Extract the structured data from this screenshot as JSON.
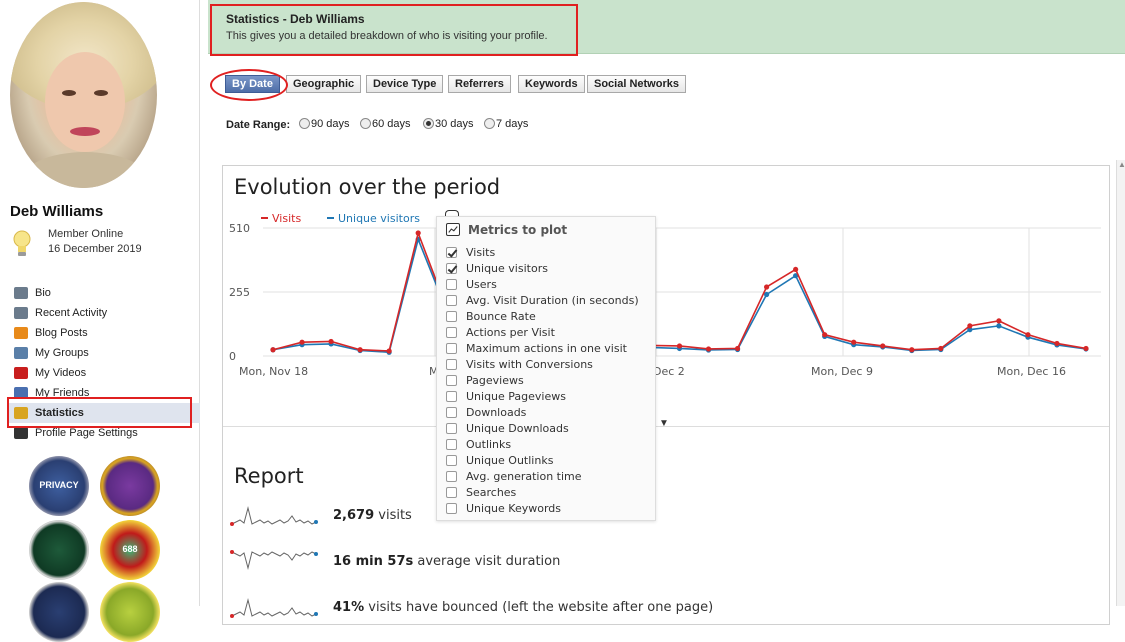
{
  "profile": {
    "name": "Deb Williams",
    "status": "Member Online",
    "date": "16 December 2019"
  },
  "sidebar": {
    "items": [
      {
        "label": "Bio",
        "icon": "document-icon",
        "color": "#6b7b8c"
      },
      {
        "label": "Recent Activity",
        "icon": "activity-icon",
        "color": "#6b7b8c"
      },
      {
        "label": "Blog Posts",
        "icon": "rss-icon",
        "color": "#e88a1a"
      },
      {
        "label": "My Groups",
        "icon": "groups-icon",
        "color": "#5a7fa8"
      },
      {
        "label": "My Videos",
        "icon": "video-icon",
        "color": "#c81e1e"
      },
      {
        "label": "My Friends",
        "icon": "friends-icon",
        "color": "#4a6fb0"
      },
      {
        "label": "Statistics",
        "icon": "bar-chart-icon",
        "color": "#d8a420"
      },
      {
        "label": "Profile Page Settings",
        "icon": "gear-icon",
        "color": "#333333"
      }
    ],
    "active_index": 6,
    "badges": [
      {
        "name": "privacy-badge",
        "label": "PRIVACY"
      },
      {
        "name": "royal-badge",
        "label": ""
      },
      {
        "name": "shield-badge",
        "label": ""
      },
      {
        "name": "mvp-rank-badge",
        "label": "688"
      },
      {
        "name": "anchor-badge",
        "label": ""
      },
      {
        "name": "member-badge",
        "label": ""
      }
    ]
  },
  "banner": {
    "title": "Statistics - Deb Williams",
    "subtitle": "This gives you a detailed breakdown of who is visiting your profile."
  },
  "tabs": [
    {
      "label": "By Date",
      "active": true
    },
    {
      "label": "Geographic"
    },
    {
      "label": "Device Type"
    },
    {
      "label": "Referrers"
    },
    {
      "label": "Keywords"
    },
    {
      "label": "Social Networks"
    }
  ],
  "date_range": {
    "label": "Date Range:",
    "options": [
      "90 days",
      "60 days",
      "30 days",
      "7 days"
    ],
    "selected": "30 days"
  },
  "evolution": {
    "title": "Evolution over the period"
  },
  "chart_data": {
    "type": "line",
    "ylim": [
      0,
      510
    ],
    "yticks": [
      0,
      255,
      510
    ],
    "xtick_labels": [
      "Mon, Nov 18",
      "M",
      "Dec 2",
      "Mon, Dec 9",
      "Mon, Dec 16"
    ],
    "legend": "top-left",
    "grid": true,
    "series": [
      {
        "name": "Visits",
        "color": "#d62728",
        "values": [
          25,
          55,
          58,
          25,
          20,
          490,
          185,
          0,
          0,
          0,
          0,
          0,
          0,
          42,
          40,
          28,
          30,
          275,
          345,
          85,
          55,
          40,
          25,
          30,
          120,
          140,
          85,
          50,
          30
        ]
      },
      {
        "name": "Unique visitors",
        "color": "#1f77b4",
        "values": [
          25,
          45,
          48,
          22,
          15,
          465,
          175,
          0,
          0,
          0,
          0,
          0,
          0,
          34,
          30,
          24,
          26,
          245,
          320,
          78,
          45,
          36,
          22,
          26,
          105,
          120,
          75,
          44,
          28
        ]
      }
    ]
  },
  "metrics": {
    "title": "Metrics to plot",
    "items": [
      {
        "label": "Visits",
        "checked": true
      },
      {
        "label": "Unique visitors",
        "checked": true
      },
      {
        "label": "Users",
        "checked": false
      },
      {
        "label": "Avg. Visit Duration (in seconds)",
        "checked": false
      },
      {
        "label": "Bounce Rate",
        "checked": false
      },
      {
        "label": "Actions per Visit",
        "checked": false
      },
      {
        "label": "Maximum actions in one visit",
        "checked": false
      },
      {
        "label": "Visits with Conversions",
        "checked": false
      },
      {
        "label": "Pageviews",
        "checked": false
      },
      {
        "label": "Unique Pageviews",
        "checked": false
      },
      {
        "label": "Downloads",
        "checked": false
      },
      {
        "label": "Unique Downloads",
        "checked": false
      },
      {
        "label": "Outlinks",
        "checked": false
      },
      {
        "label": "Unique Outlinks",
        "checked": false
      },
      {
        "label": "Avg. generation time",
        "checked": false
      },
      {
        "label": "Searches",
        "checked": false
      },
      {
        "label": "Unique Keywords",
        "checked": false
      }
    ]
  },
  "report": {
    "title": "Report",
    "rows": [
      {
        "value": "2,679",
        "text": " visits"
      },
      {
        "value": "16 min 57s",
        "text": " average visit duration"
      },
      {
        "value": "41%",
        "text": " visits have bounced (left the website after one page)"
      }
    ]
  }
}
